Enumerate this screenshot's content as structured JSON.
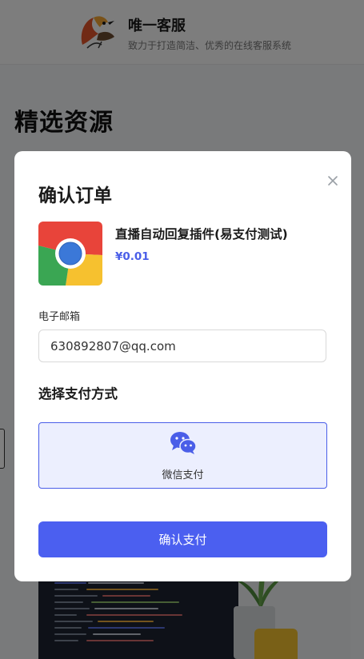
{
  "header": {
    "site_title": "唯一客服",
    "site_subtitle": "致力于打造简洁、优秀的在线客服系统",
    "logo_icon": "bird-logo-icon"
  },
  "page": {
    "section_title": "精选资源"
  },
  "modal": {
    "title": "确认订单",
    "close_icon": "close-icon",
    "product": {
      "name": "直播自动回复插件(易支付测试)",
      "price": "¥0.01",
      "image_icon": "chrome-icon"
    },
    "email": {
      "label": "电子邮箱",
      "value": "630892807@qq.com"
    },
    "payment": {
      "heading": "选择支付方式",
      "options": [
        {
          "label": "微信支付",
          "icon": "wechat-icon",
          "selected": true
        }
      ]
    },
    "confirm_label": "确认支付"
  },
  "colors": {
    "accent": "#4b5ff0",
    "overlay": "rgba(0,0,0,0.5)",
    "selected_bg": "#eceffe",
    "price": "#4a5ee8"
  }
}
